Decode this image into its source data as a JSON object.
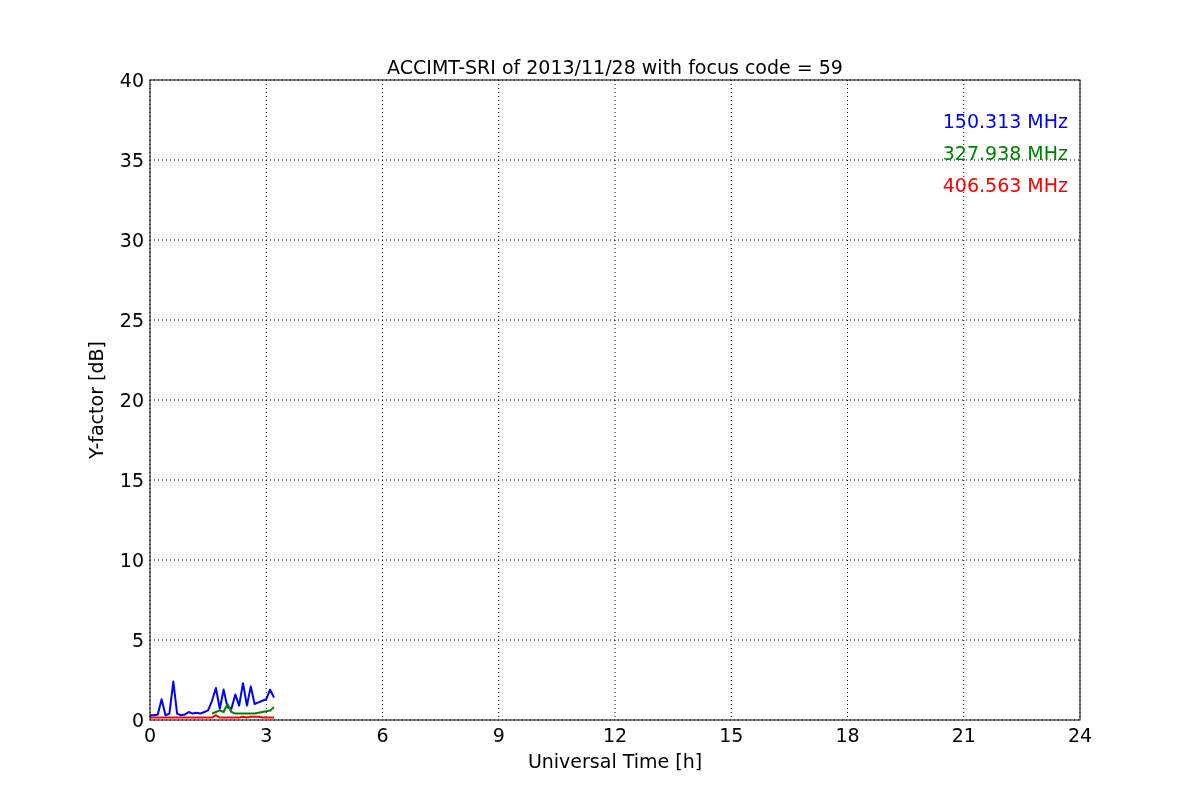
{
  "chart_data": {
    "type": "line",
    "title": "ACCIMT-SRI of 2013/11/28 with focus code = 59",
    "xlabel": "Universal Time [h]",
    "ylabel": "Y-factor [dB]",
    "x": [
      0,
      0.1,
      0.2,
      0.3,
      0.4,
      0.5,
      0.6,
      0.7,
      0.8,
      0.9,
      1.0,
      1.1,
      1.2,
      1.3,
      1.4,
      1.5,
      1.6,
      1.7,
      1.8,
      1.9,
      2.0,
      2.1,
      2.2,
      2.3,
      2.4,
      2.5,
      2.6,
      2.7,
      2.8,
      2.9,
      3.0,
      3.1,
      3.2
    ],
    "series": [
      {
        "name": "150.313 MHz",
        "color": "#0000ff",
        "values": [
          0.3,
          0.3,
          0.35,
          1.3,
          0.3,
          0.4,
          2.4,
          0.4,
          0.3,
          0.35,
          0.5,
          0.4,
          0.45,
          0.4,
          0.5,
          0.6,
          1.2,
          2.0,
          0.7,
          1.9,
          0.8,
          0.7,
          1.6,
          0.9,
          2.3,
          0.9,
          2.1,
          1.0,
          1.1,
          1.2,
          1.3,
          1.9,
          1.4
        ]
      },
      {
        "name": "327.938 MHz",
        "color": "#008000",
        "values": [
          null,
          null,
          null,
          null,
          null,
          null,
          null,
          null,
          null,
          null,
          null,
          null,
          null,
          null,
          null,
          null,
          0.4,
          0.5,
          0.6,
          0.5,
          1.0,
          0.5,
          0.4,
          0.4,
          0.4,
          0.4,
          0.4,
          0.4,
          0.45,
          0.5,
          0.55,
          0.6,
          0.8
        ]
      },
      {
        "name": "406.563 MHz",
        "color": "#ff0000",
        "values": [
          0.15,
          0.15,
          0.15,
          0.15,
          0.15,
          0.15,
          0.15,
          0.15,
          0.15,
          0.15,
          0.15,
          0.15,
          0.15,
          0.15,
          0.15,
          0.15,
          0.15,
          0.3,
          0.15,
          0.15,
          0.15,
          0.15,
          0.15,
          0.15,
          0.2,
          0.15,
          0.2,
          0.2,
          0.2,
          0.15,
          0.15,
          0.15,
          0.15
        ]
      }
    ],
    "grid": true,
    "xlim": [
      0,
      24
    ],
    "ylim": [
      0,
      40
    ],
    "xticks": [
      0,
      3,
      6,
      9,
      12,
      15,
      18,
      21,
      24
    ],
    "yticks": [
      0,
      5,
      10,
      15,
      20,
      25,
      30,
      35,
      40
    ]
  }
}
